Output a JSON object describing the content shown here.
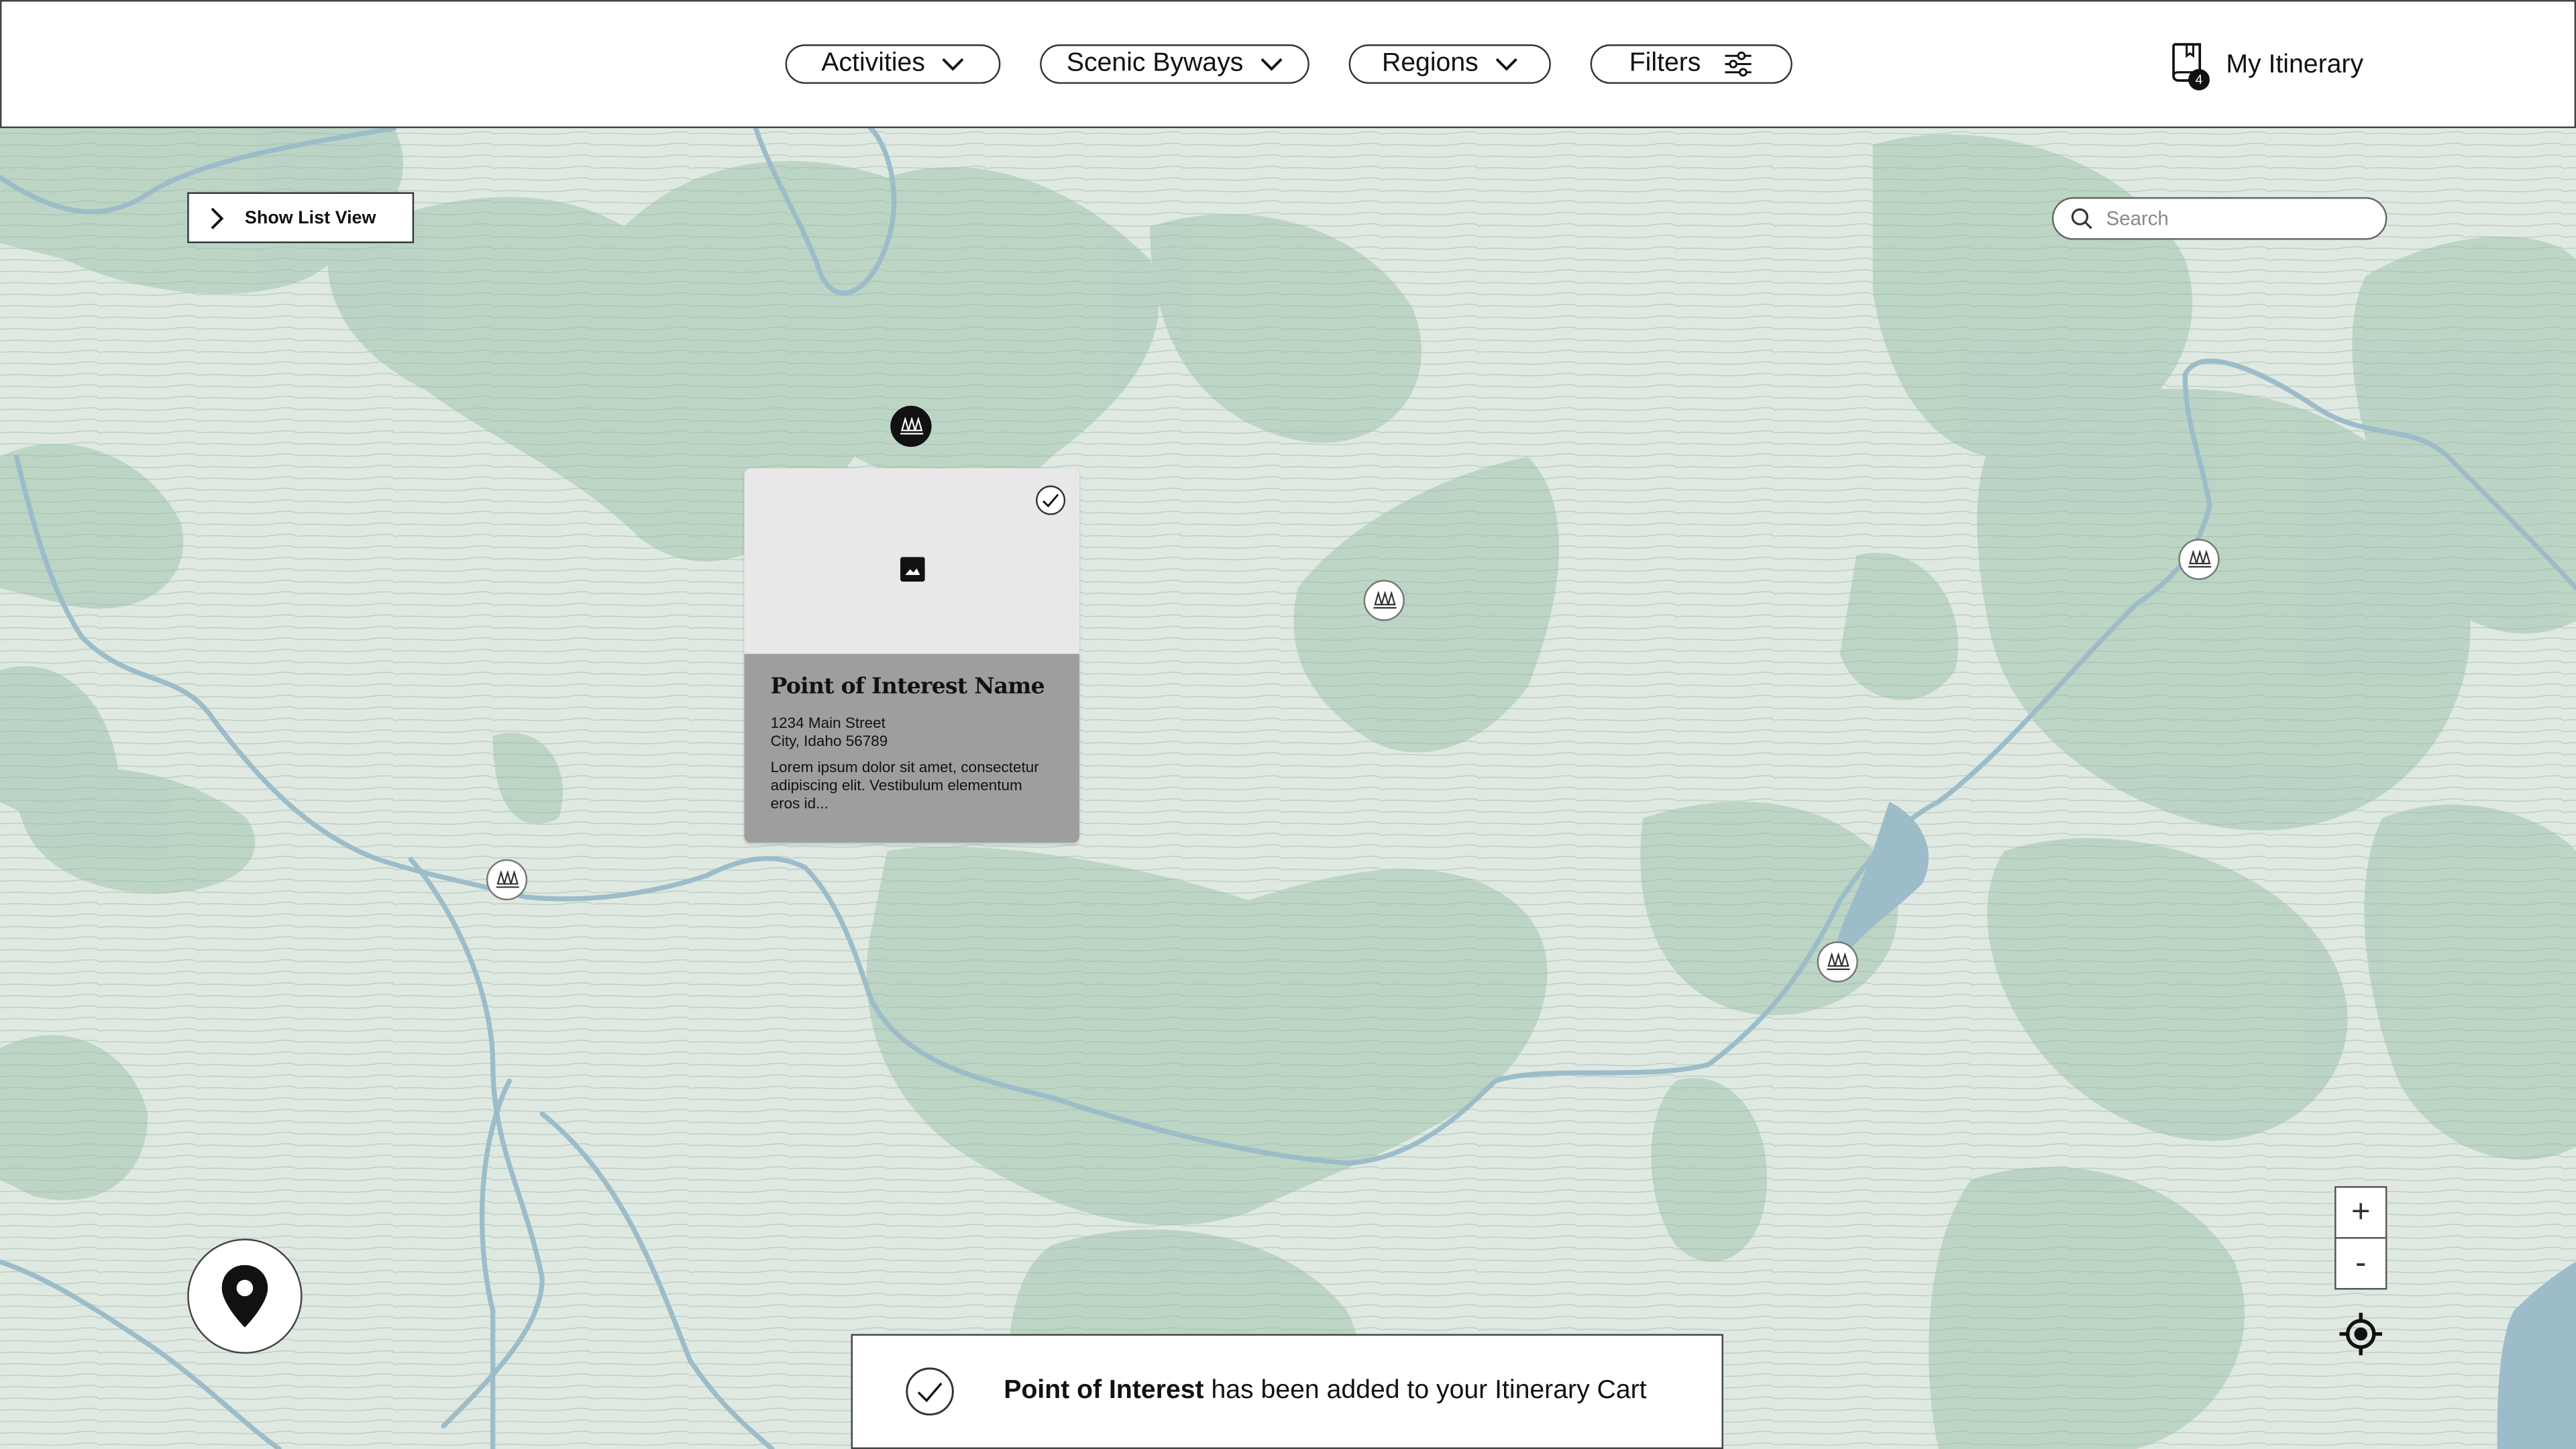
{
  "header": {
    "nav": [
      {
        "label": "Activities",
        "icon": "chevron-down-icon"
      },
      {
        "label": "Scenic Byways",
        "icon": "chevron-down-icon"
      },
      {
        "label": "Regions",
        "icon": "chevron-down-icon"
      },
      {
        "label": "Filters",
        "icon": "sliders-icon"
      }
    ],
    "itinerary": {
      "label": "My Itinerary",
      "count": "4"
    }
  },
  "map": {
    "list_view_label": "Show List View",
    "search_placeholder": "Search",
    "zoom_in": "+",
    "zoom_out": "-"
  },
  "popup": {
    "title": "Point of Interest Name",
    "address_line1": "1234 Main Street",
    "address_line2": "City, Idaho 56789",
    "description": "Lorem ipsum dolor sit amet, consectetur adipiscing elit. Vestibulum elementum eros id..."
  },
  "toast": {
    "bold": "Point of Interest",
    "rest": " has been added to your Itinerary Cart"
  },
  "colors": {
    "map_base": "#dfe9e2",
    "map_shade": "#b3cfbd",
    "river": "#9dbcc9",
    "card_body": "#9e9e9e"
  }
}
